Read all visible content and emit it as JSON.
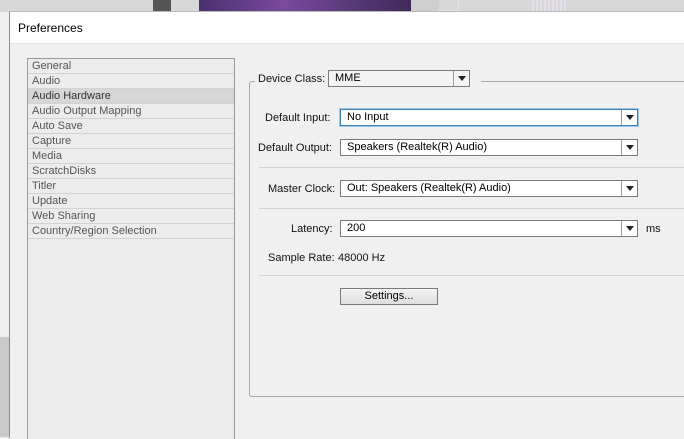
{
  "window": {
    "title": "Preferences"
  },
  "categories": [
    {
      "label": "General",
      "selected": false
    },
    {
      "label": "Audio",
      "selected": false
    },
    {
      "label": "Audio Hardware",
      "selected": true
    },
    {
      "label": "Audio Output Mapping",
      "selected": false
    },
    {
      "label": "Auto Save",
      "selected": false
    },
    {
      "label": "Capture",
      "selected": false
    },
    {
      "label": "Media",
      "selected": false
    },
    {
      "label": "ScratchDisks",
      "selected": false
    },
    {
      "label": "Titler",
      "selected": false
    },
    {
      "label": "Update",
      "selected": false
    },
    {
      "label": "Web Sharing",
      "selected": false
    },
    {
      "label": "Country/Region Selection",
      "selected": false
    }
  ],
  "audio_hardware": {
    "device_class_label": "Device Class:",
    "device_class_value": "MME",
    "default_input_label": "Default Input:",
    "default_input_value": "No Input",
    "default_output_label": "Default Output:",
    "default_output_value": "Speakers (Realtek(R) Audio)",
    "master_clock_label": "Master Clock:",
    "master_clock_value": "Out: Speakers (Realtek(R) Audio)",
    "latency_label": "Latency:",
    "latency_value": "200",
    "latency_unit": "ms",
    "sample_rate_label": "Sample Rate:",
    "sample_rate_value": "48000 Hz",
    "settings_button": "Settings..."
  },
  "colors": {
    "focus": "#3c7fb1",
    "selected_item": "#d6d6d6"
  }
}
